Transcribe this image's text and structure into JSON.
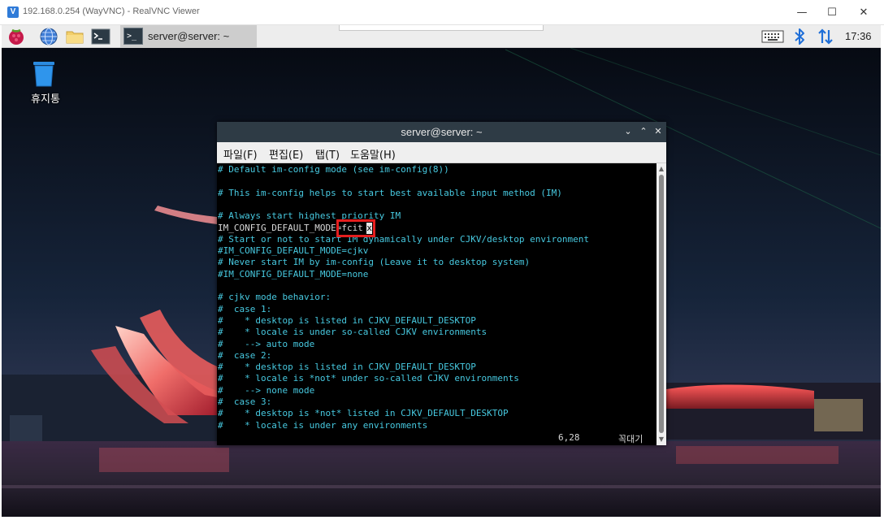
{
  "vnc_window": {
    "title": "192.168.0.254 (WayVNC) - RealVNC Viewer",
    "app_icon_glyph": "V",
    "controls": {
      "minimize": "—",
      "maximize": "☐",
      "close": "✕"
    }
  },
  "taskbar": {
    "launchers": [
      "raspberry-menu-icon",
      "web-browser-icon",
      "file-manager-icon",
      "terminal-icon"
    ],
    "active_window_label": "server@server: ~",
    "tray_icons": [
      "keyboard-icon",
      "bluetooth-icon",
      "network-icon"
    ],
    "clock": "17:36",
    "terminal_glyph": ">_"
  },
  "desktop": {
    "trash_label": "휴지통"
  },
  "terminal": {
    "title": "server@server: ~",
    "controls": {
      "minimize": "⌄",
      "maximize": "⌃",
      "close": "✕"
    },
    "menu": [
      {
        "label": "파일(F)"
      },
      {
        "label": "편집(E)"
      },
      {
        "label": "탭(T)"
      },
      {
        "label": "도움말(H)"
      }
    ],
    "lines": [
      {
        "text": "# Default im-config mode (see im-config(8))",
        "plain": false
      },
      {
        "text": "",
        "plain": false
      },
      {
        "text": "# This im-config helps to start best available input method (IM)",
        "plain": false
      },
      {
        "text": "",
        "plain": false
      },
      {
        "text": "# Always start highest priority IM",
        "plain": false
      },
      {
        "text": "IM_CONFIG_DEFAULT_MODE=fcitx",
        "plain": true
      },
      {
        "text": "# Start or not to start IM dynamically under CJKV/desktop environment",
        "plain": false
      },
      {
        "text": "#IM_CONFIG_DEFAULT_MODE=cjkv",
        "plain": false
      },
      {
        "text": "# Never start IM by im-config (Leave it to desktop system)",
        "plain": false
      },
      {
        "text": "#IM_CONFIG_DEFAULT_MODE=none",
        "plain": false
      },
      {
        "text": "",
        "plain": false
      },
      {
        "text": "# cjkv mode behavior:",
        "plain": false
      },
      {
        "text": "#  case 1:",
        "plain": false
      },
      {
        "text": "#    * desktop is listed in CJKV_DEFAULT_DESKTOP",
        "plain": false
      },
      {
        "text": "#    * locale is under so-called CJKV environments",
        "plain": false
      },
      {
        "text": "#    --> auto mode",
        "plain": false
      },
      {
        "text": "#  case 2:",
        "plain": false
      },
      {
        "text": "#    * desktop is listed in CJKV_DEFAULT_DESKTOP",
        "plain": false
      },
      {
        "text": "#    * locale is *not* under so-called CJKV environments",
        "plain": false
      },
      {
        "text": "#    --> none mode",
        "plain": false
      },
      {
        "text": "#  case 3:",
        "plain": false
      },
      {
        "text": "#    * desktop is *not* listed in CJKV_DEFAULT_DESKTOP",
        "plain": false
      },
      {
        "text": "#    * locale is under any environments",
        "plain": false
      }
    ],
    "cursor_char": "x",
    "status_position": "6,28",
    "status_mode": "꼭대기"
  },
  "colors": {
    "comment_text": "#47c9e0",
    "plain_text": "#d8d8d8",
    "highlight_box": "#e51e1e",
    "terminal_titlebar": "#2e3b45"
  }
}
